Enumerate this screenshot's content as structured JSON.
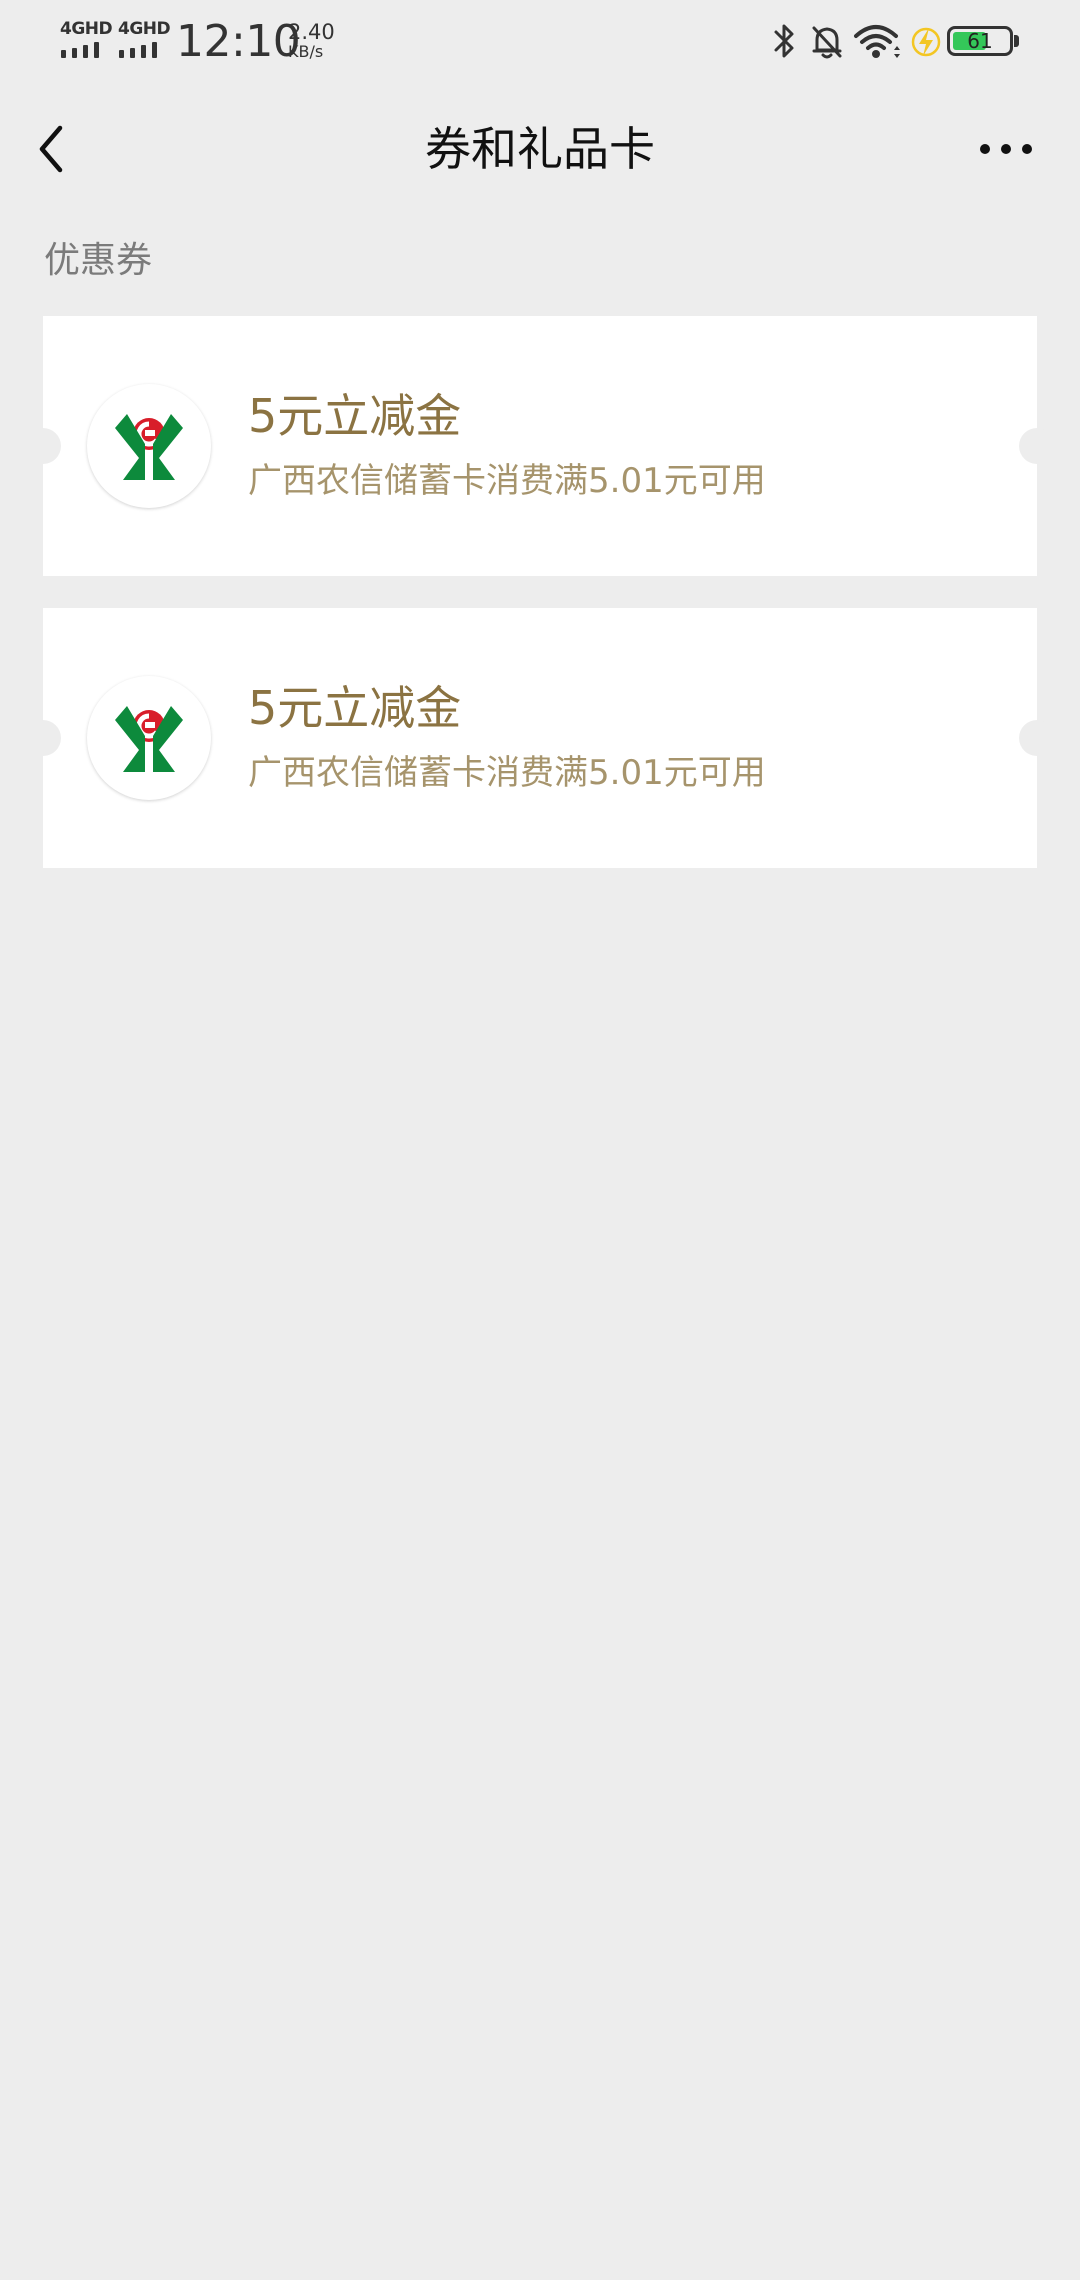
{
  "status_bar": {
    "network_1": "4GHD",
    "network_2": "4GHD",
    "time": "12:10",
    "speed_value": "2.40",
    "speed_unit": "KB/s",
    "battery_level": "61",
    "battery_fraction": 0.61,
    "battery_color": "#34c759",
    "icons": [
      "bluetooth-icon",
      "mute-bell-icon",
      "wifi-icon",
      "charging-bolt-icon"
    ]
  },
  "nav": {
    "title": "券和礼品卡",
    "back_icon": "chevron-left-icon",
    "more_icon": "more-dots-icon"
  },
  "section": {
    "label": "优惠券"
  },
  "coupons": [
    {
      "logo": "rural-credit-cooperative-logo",
      "title": "5元立减金",
      "description": "广西农信储蓄卡消费满5.01元可用"
    },
    {
      "logo": "rural-credit-cooperative-logo",
      "title": "5元立减金",
      "description": "广西农信储蓄卡消费满5.01元可用"
    }
  ],
  "colors": {
    "background": "#ededed",
    "coupon_title": "#8b7342",
    "coupon_desc": "#a6946c",
    "logo_green": "#0d8a3c",
    "logo_red": "#d81e2a"
  }
}
